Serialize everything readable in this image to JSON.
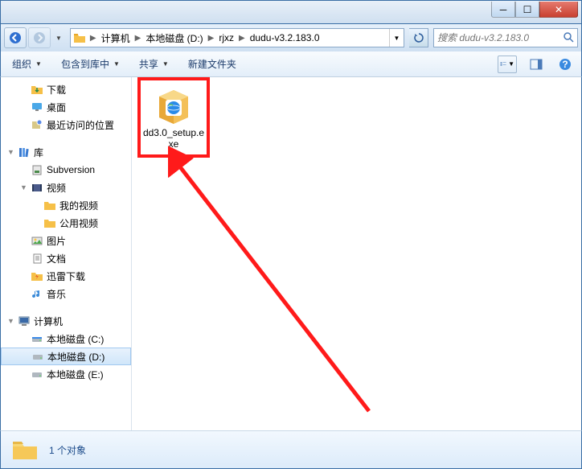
{
  "titlebar": {
    "min_glyph": "─",
    "max_glyph": "☐",
    "close_glyph": "✕"
  },
  "breadcrumb": {
    "items": [
      "计算机",
      "本地磁盘 (D:)",
      "rjxz",
      "dudu-v3.2.183.0"
    ]
  },
  "search": {
    "placeholder": "搜索 dudu-v3.2.183.0"
  },
  "toolbar": {
    "organize": "组织",
    "include": "包含到库中",
    "share": "共享",
    "newfolder": "新建文件夹"
  },
  "sidebar": {
    "group1": [
      {
        "label": "下载",
        "icon": "download",
        "indent": 24
      },
      {
        "label": "桌面",
        "icon": "desktop",
        "indent": 24
      },
      {
        "label": "最近访问的位置",
        "icon": "recent",
        "indent": 24
      }
    ],
    "group2_header": {
      "label": "库",
      "icon": "library",
      "indent": 8,
      "expander": "▼"
    },
    "group2": [
      {
        "label": "Subversion",
        "icon": "svn",
        "indent": 24
      },
      {
        "label": "视频",
        "icon": "video",
        "indent": 24,
        "expander": "▼"
      },
      {
        "label": "我的视频",
        "icon": "folder",
        "indent": 40
      },
      {
        "label": "公用视频",
        "icon": "folder",
        "indent": 40
      },
      {
        "label": "图片",
        "icon": "image",
        "indent": 24
      },
      {
        "label": "文档",
        "icon": "doc",
        "indent": 24
      },
      {
        "label": "迅雷下载",
        "icon": "thunder",
        "indent": 24
      },
      {
        "label": "音乐",
        "icon": "music",
        "indent": 24
      }
    ],
    "group3_header": {
      "label": "计算机",
      "icon": "computer",
      "indent": 8,
      "expander": "▼"
    },
    "group3": [
      {
        "label": "本地磁盘 (C:)",
        "icon": "drive",
        "indent": 24
      },
      {
        "label": "本地磁盘 (D:)",
        "icon": "drive",
        "indent": 24,
        "selected": true
      },
      {
        "label": "本地磁盘 (E:)",
        "icon": "drive",
        "indent": 24
      }
    ]
  },
  "content": {
    "file": {
      "name": "dd3.0_setup.exe"
    }
  },
  "status": {
    "text": "1 个对象"
  }
}
